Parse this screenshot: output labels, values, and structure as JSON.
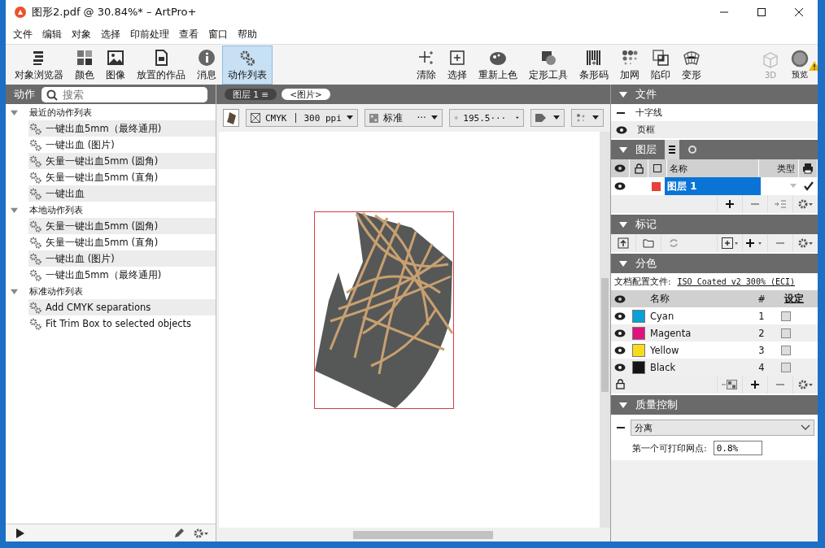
{
  "window": {
    "title": "图形2.pdf @ 30.84%* – ArtPro+"
  },
  "menu": [
    "文件",
    "编辑",
    "对象",
    "选择",
    "印前处理",
    "查看",
    "窗口",
    "帮助"
  ],
  "toolbar": {
    "left": [
      {
        "label": "对象浏览器",
        "selected": false
      },
      {
        "label": "颜色",
        "selected": false
      },
      {
        "label": "图像",
        "selected": false
      },
      {
        "label": "放置的作品",
        "selected": false
      },
      {
        "label": "消息",
        "selected": false
      },
      {
        "label": "动作列表",
        "selected": true
      }
    ],
    "right": [
      {
        "label": "清除",
        "disabled": false,
        "warning": false
      },
      {
        "label": "选择",
        "disabled": false,
        "warning": false
      },
      {
        "label": "重新上色",
        "disabled": false,
        "warning": false
      },
      {
        "label": "定形工具",
        "disabled": false,
        "warning": false
      },
      {
        "label": "条形码",
        "disabled": false,
        "warning": false
      },
      {
        "label": "加网",
        "disabled": false,
        "warning": false
      },
      {
        "label": "陷印",
        "disabled": false,
        "warning": false
      },
      {
        "label": "变形",
        "disabled": false,
        "warning": false
      },
      {
        "label": "3D",
        "disabled": true,
        "warning": false
      },
      {
        "label": "预览",
        "disabled": false,
        "warning": true
      }
    ]
  },
  "actions": {
    "title": "动作",
    "search": {
      "placeholder": "搜索"
    },
    "groups": [
      {
        "label": "最近的动作列表",
        "expanded": true,
        "children": [
          {
            "label": "一键出血5mm（最终通用)"
          },
          {
            "label": "一键出血 (图片)"
          },
          {
            "label": "矢量一键出血5mm (圆角)"
          },
          {
            "label": "矢量一键出血5mm (直角)"
          },
          {
            "label": "一键出血"
          }
        ]
      },
      {
        "label": "本地动作列表",
        "expanded": true,
        "children": [
          {
            "label": "矢量一键出血5mm (圆角)"
          },
          {
            "label": "矢量一键出血5mm (直角)"
          },
          {
            "label": "一键出血 (图片)"
          },
          {
            "label": "一键出血5mm（最终通用)"
          }
        ]
      },
      {
        "label": "标准动作列表",
        "expanded": true,
        "children": [
          {
            "label": "Add CMYK separations"
          },
          {
            "label": "Fit Trim Box to selected objects"
          }
        ]
      }
    ]
  },
  "breadcrumb": [
    {
      "label": "图层 1 ≡",
      "selected": false
    },
    {
      "label": "<图片>",
      "selected": true
    }
  ],
  "canvas_toolbar": {
    "color_mode": "CMYK",
    "resolution": "300 ppi",
    "mode": "标准",
    "mode_more": "···",
    "position": "195.5···"
  },
  "document": {
    "title": "文件",
    "expanded": true,
    "rows": [
      {
        "label": "十字线",
        "kind": "dash"
      },
      {
        "label": "页框",
        "kind": "eye"
      }
    ]
  },
  "layers": {
    "title": "图层",
    "expanded": true,
    "columns": {
      "name": "名称",
      "type": "类型"
    },
    "rows": [
      {
        "name": "图层 1",
        "visible": true,
        "color": "#e8403a",
        "selected": true,
        "printable": true
      }
    ]
  },
  "marks": {
    "title": "标记",
    "expanded": true
  },
  "separations": {
    "title": "分色",
    "expanded": true,
    "profile_label": "文档配置文件:",
    "profile": "ISO Coated v2 300% (ECI)",
    "columns": {
      "name": "名称",
      "number": "#",
      "setting": "设定"
    },
    "rows": [
      {
        "name": "Cyan",
        "number": "1",
        "color": "#0aa0d8",
        "visible": true,
        "checked": false
      },
      {
        "name": "Magenta",
        "number": "2",
        "color": "#e0127e",
        "visible": true,
        "checked": false
      },
      {
        "name": "Yellow",
        "number": "3",
        "color": "#f8dc1c",
        "visible": true,
        "checked": false
      },
      {
        "name": "Black",
        "number": "4",
        "color": "#141414",
        "visible": true,
        "checked": false
      }
    ]
  },
  "quality": {
    "title": "质量控制",
    "expanded": true,
    "check": "分离",
    "field_label": "第一个可打印网点:",
    "field_value": "0.8%"
  }
}
